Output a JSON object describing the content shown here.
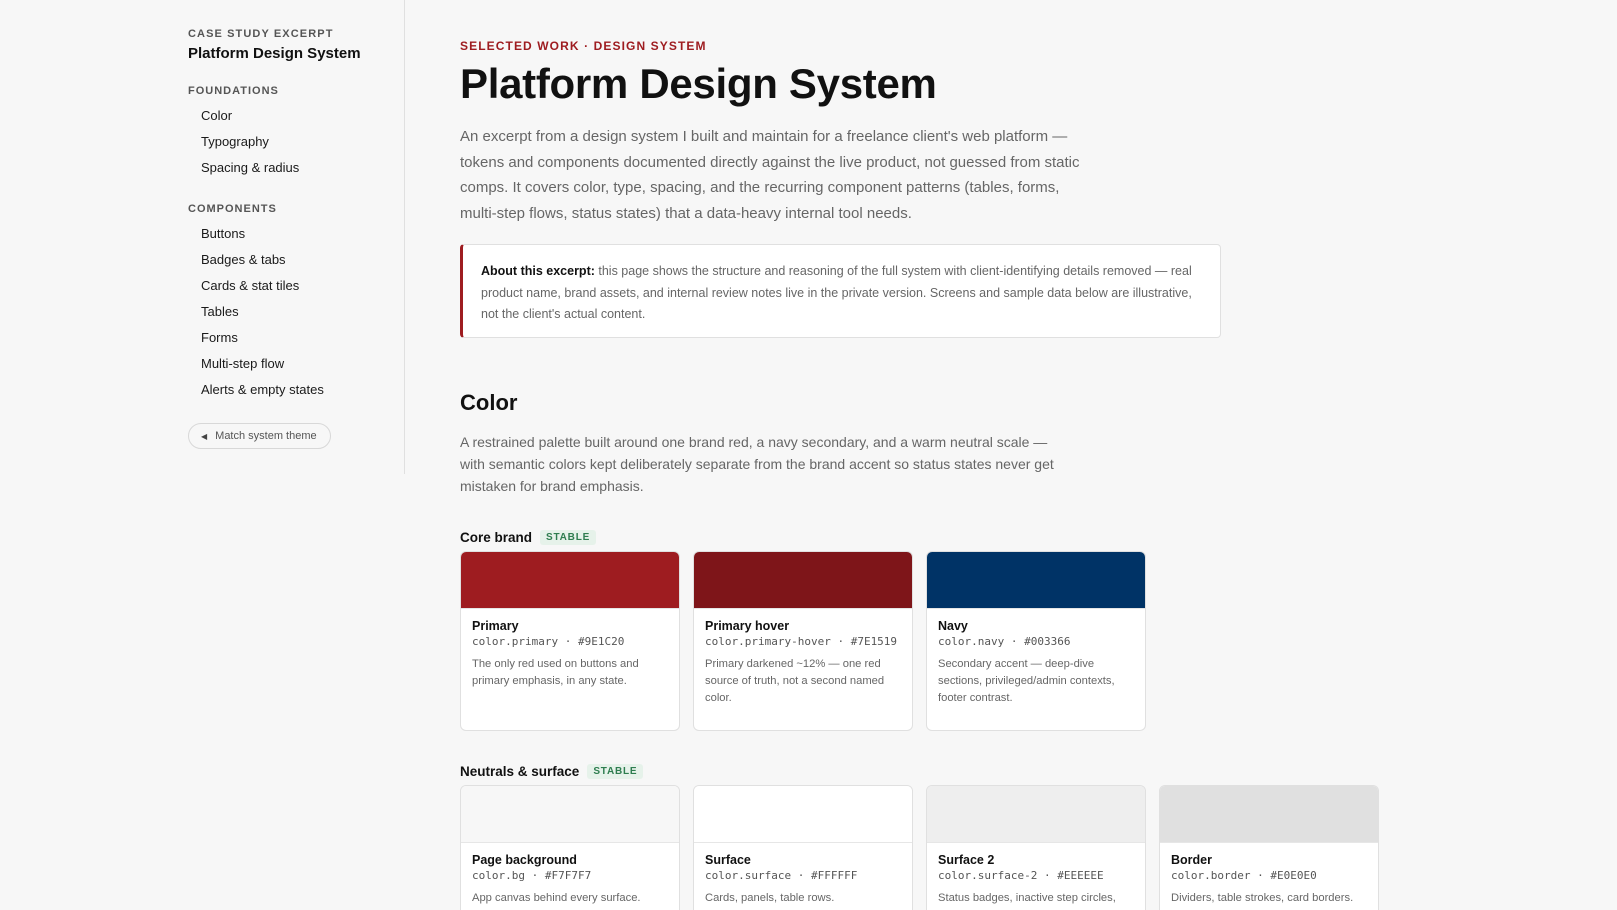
{
  "sidebar": {
    "eyebrow": "CASE STUDY EXCERPT",
    "title": "Platform Design System",
    "groups": [
      {
        "label": "FOUNDATIONS",
        "items": [
          "Color",
          "Typography",
          "Spacing & radius"
        ]
      },
      {
        "label": "COMPONENTS",
        "items": [
          "Buttons",
          "Badges & tabs",
          "Cards & stat tiles",
          "Tables",
          "Forms",
          "Multi-step flow",
          "Alerts & empty states"
        ]
      }
    ],
    "theme_button": "Match system theme"
  },
  "header": {
    "kicker": "SELECTED WORK · DESIGN SYSTEM",
    "title": "Platform Design System",
    "intro": "An excerpt from a design system I built and maintain for a freelance client's web platform — tokens and components documented directly against the live product, not guessed from static comps. It covers color, type, spacing, and the recurring component patterns (tables, forms, multi-step flows, status states) that a data-heavy internal tool needs."
  },
  "callout": {
    "lead": "About this excerpt:",
    "text": " this page shows the structure and reasoning of the full system with client-identifying details removed — real product name, brand assets, and internal review notes live in the private version. Screens and sample data below are illustrative, not the client's actual content."
  },
  "color_section": {
    "title": "Color",
    "description": "A restrained palette built around one brand red, a navy secondary, and a warm neutral scale — with semantic colors kept deliberately separate from the brand accent so status states never get mistaken for brand emphasis.",
    "groups": [
      {
        "name": "Core brand",
        "badge": "STABLE",
        "cards": [
          {
            "name": "Primary",
            "token": "color.primary · #9E1C20",
            "hex": "#9E1C20",
            "desc": "The only red used on buttons and primary emphasis, in any state."
          },
          {
            "name": "Primary hover",
            "token": "color.primary-hover · #7E1519",
            "hex": "#7E1519",
            "desc": "Primary darkened ~12% — one red source of truth, not a second named color."
          },
          {
            "name": "Navy",
            "token": "color.navy · #003366",
            "hex": "#003366",
            "desc": "Secondary accent — deep-dive sections, privileged/admin contexts, footer contrast."
          }
        ]
      },
      {
        "name": "Neutrals & surface",
        "badge": "STABLE",
        "cards": [
          {
            "name": "Page background",
            "token": "color.bg · #F7F7F7",
            "hex": "#F7F7F7",
            "desc": "App canvas behind every surface."
          },
          {
            "name": "Surface",
            "token": "color.surface · #FFFFFF",
            "hex": "#FFFFFF",
            "desc": "Cards, panels, table rows."
          },
          {
            "name": "Surface 2",
            "token": "color.surface-2 · #EEEEEE",
            "hex": "#EEEEEE",
            "desc": "Status badges, inactive step circles, muted backgrounds."
          },
          {
            "name": "Border",
            "token": "color.border · #E0E0E0",
            "hex": "#E0E0E0",
            "desc": "Dividers, table strokes, card borders."
          }
        ]
      }
    ]
  }
}
